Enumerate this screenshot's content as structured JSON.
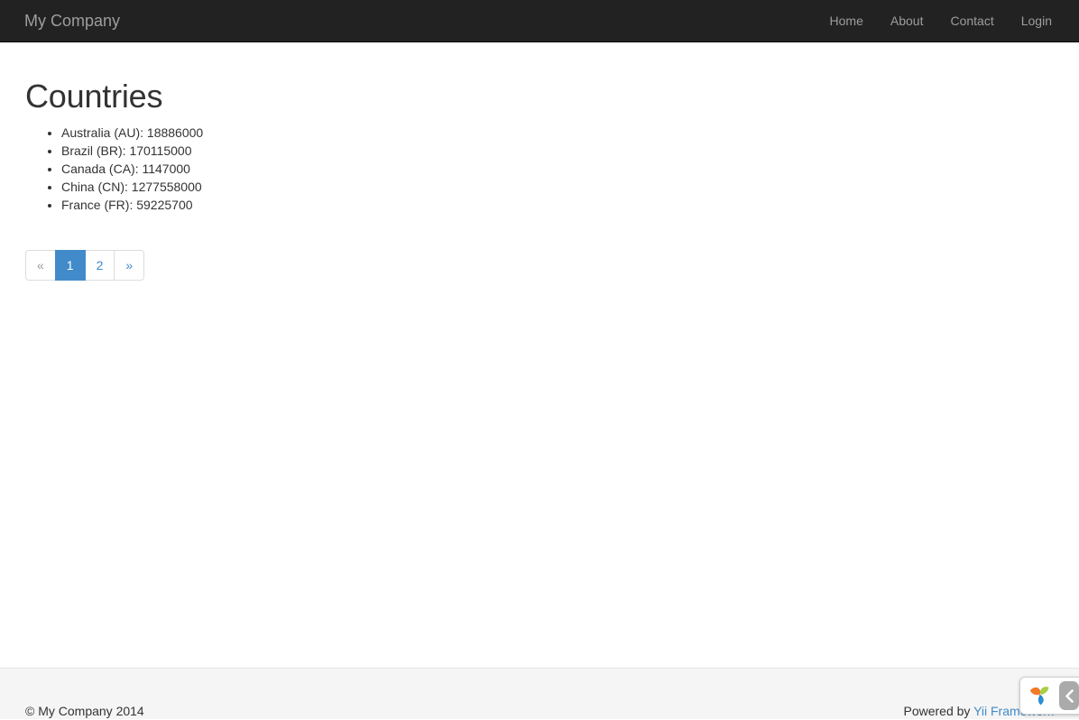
{
  "navbar": {
    "brand": "My Company",
    "links": [
      {
        "label": "Home",
        "name": "nav-link-home"
      },
      {
        "label": "About",
        "name": "nav-link-about"
      },
      {
        "label": "Contact",
        "name": "nav-link-contact"
      },
      {
        "label": "Login",
        "name": "nav-link-login"
      }
    ]
  },
  "main": {
    "title": "Countries",
    "countries": [
      "Australia (AU): 18886000",
      "Brazil (BR): 170115000",
      "Canada (CA): 1147000",
      "China (CN): 1277558000",
      "France (FR): 59225700"
    ],
    "pagination": {
      "prev": "«",
      "page1": "1",
      "page2": "2",
      "next": "»",
      "active_page": "1"
    }
  },
  "footer": {
    "copyright": "© My Company 2014",
    "powered_prefix": "Powered by ",
    "powered_link": "Yii Framework"
  },
  "debug_toolbar": {
    "toggle_glyph": "‹"
  },
  "colors": {
    "navbar_bg": "#222222",
    "navbar_text": "#9d9d9d",
    "link_blue": "#428bca",
    "body_text": "#333333",
    "footer_bg": "#f5f5f5",
    "border_grey": "#dddddd",
    "disabled_text": "#999999"
  }
}
